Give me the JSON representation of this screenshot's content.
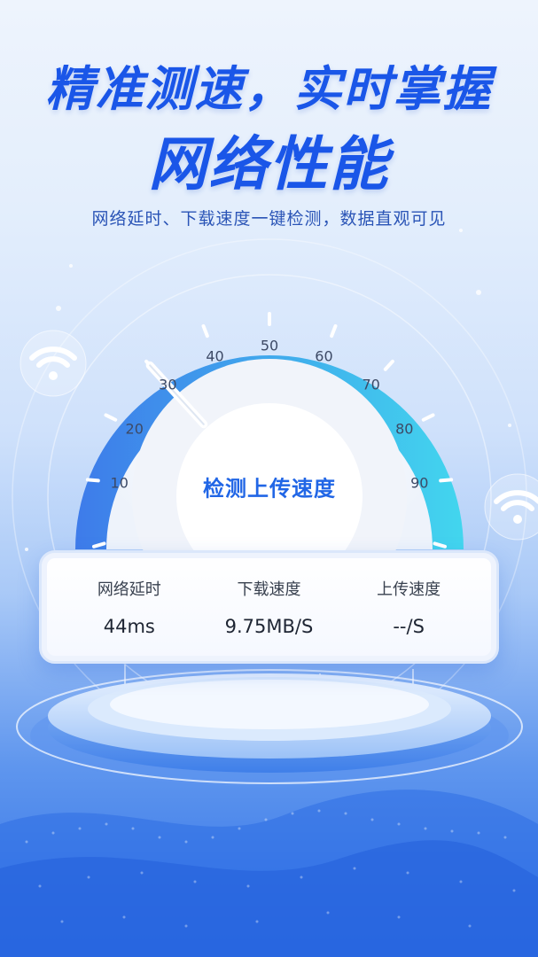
{
  "headline": {
    "line1": "精准测速，实时掌握",
    "line2": "网络性能"
  },
  "subheadline": "网络延时、下载速度一键检测，数据直观可见",
  "gauge": {
    "center_text": "检测上传速度",
    "tick_labels": [
      "10",
      "20",
      "30",
      "40",
      "50",
      "60",
      "70",
      "80",
      "90"
    ],
    "needle_value": 30,
    "colors": {
      "arc_start": "#3e7bea",
      "arc_end": "#42d6ee",
      "center_text": "#2166e6"
    }
  },
  "stats": [
    {
      "label": "网络延时",
      "value": "44ms"
    },
    {
      "label": "下载速度",
      "value": "9.75MB/S"
    },
    {
      "label": "上传速度",
      "value": "--/S"
    }
  ],
  "icons": {
    "left": "wifi-icon",
    "right": "wifi-icon"
  },
  "colors": {
    "headline": "#1a56e8",
    "subheadline": "#2a54b6",
    "background_bottom": "#2d6fe6"
  }
}
